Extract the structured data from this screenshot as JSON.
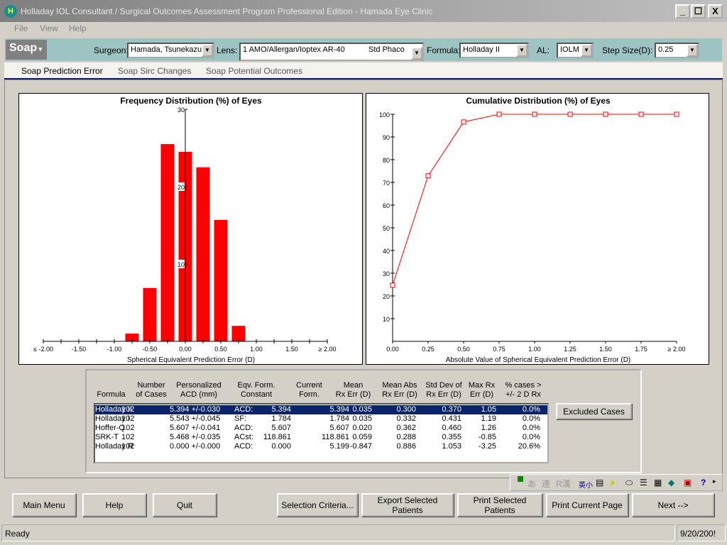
{
  "window": {
    "title": "Holladay IOL Consultant / Surgical Outcomes Assessment Program Professional Edition - Hamada Eye Clinic",
    "min": "_",
    "max": "☐",
    "close": "X",
    "logo": "H"
  },
  "menu": [
    "File",
    "View",
    "Help"
  ],
  "toolbar": {
    "soap": "Soap",
    "surgeon_label": "Surgeon:",
    "surgeon": "Hamada, Tsunekazu",
    "lens_label": "Lens:",
    "lens": "1  AMO/Allergan/Ioptex AR-40",
    "lens_type": "Std Phaco",
    "formula_label": "Formula:",
    "formula": "Holladay II",
    "al_label": "AL:",
    "al": "IOLM",
    "step_label": "Step Size(D):",
    "step": "0.25"
  },
  "tabs": [
    "Soap Prediction Error",
    "Soap Sirc Changes",
    "Soap Potential Outcomes"
  ],
  "chart_data": [
    {
      "type": "bar",
      "title": "Frequency Distribution (%) of Eyes",
      "xlabel": "Spherical Equivalent Prediction Error (D)",
      "ylabel": "",
      "x_tick_labels": [
        "≤ -2.00",
        "-1.50",
        "-1.00",
        "-0.50",
        "0.00",
        "0.50",
        "1.00",
        "1.50",
        "≥ 2.00"
      ],
      "y_tick_labels": [
        "10",
        "20",
        "30"
      ],
      "xlim": [
        -2,
        2
      ],
      "ylim": [
        0,
        30
      ],
      "categories": [
        -0.75,
        -0.5,
        -0.25,
        0,
        0.25,
        0.5,
        0.75
      ],
      "values": [
        1.0,
        6.9,
        25.5,
        24.5,
        22.5,
        15.7,
        2.0
      ],
      "color": "#ff0000",
      "grid": false
    },
    {
      "type": "line",
      "title": "Cumulative Distribution (%) of Eyes",
      "xlabel": "Absolute Value of Spherical Equivalent Prediction Error (D)",
      "ylabel": "",
      "x_tick_labels": [
        "0.00",
        "0.25",
        "0.50",
        "0.75",
        "1.00",
        "1.25",
        "1.50",
        "1.75",
        "≥ 2.00"
      ],
      "y_tick_labels": [
        "10",
        "20",
        "30",
        "40",
        "50",
        "60",
        "70",
        "80",
        "90",
        "100"
      ],
      "xlim": [
        0,
        2
      ],
      "ylim": [
        0,
        100
      ],
      "x": [
        0,
        0.25,
        0.5,
        0.75,
        1,
        1.25,
        1.5,
        1.75,
        2
      ],
      "values": [
        24.7,
        72.9,
        96.6,
        100,
        100,
        100,
        100,
        100,
        100
      ],
      "color": "#ff0000",
      "marker": "square",
      "grid": false
    }
  ],
  "table": {
    "headers": [
      "Formula",
      "Number\nof Cases",
      "Personalized\nACD (mm)",
      "Eqv. Form.\nConstant",
      "Current\nForm.",
      "Mean\nRx Err (D)",
      "Mean Abs\nRx Err (D)",
      "Std Dev of\nRx Err (D)",
      "Max Rx\nErr (D)",
      "% cases >\n+/- 2 D Rx"
    ],
    "rows": [
      [
        "Holladay II",
        "102",
        "5.394 +/-0.030",
        "ACD:",
        "5.394",
        "5.394",
        "0.035",
        "0.300",
        "0.370",
        "1.05",
        "0.0%"
      ],
      [
        "Holladay I",
        "102",
        "5.543 +/-0.045",
        "SF:",
        "1.784",
        "1.784",
        "0.035",
        "0.332",
        "0.431",
        "1.19",
        "0.0%"
      ],
      [
        "Hoffer-Q",
        "102",
        "5.607 +/-0.041",
        "ACD:",
        "5.607",
        "5.607",
        "0.020",
        "0.362",
        "0.460",
        "1.26",
        "0.0%"
      ],
      [
        "SRK-T",
        "102",
        "5.468 +/-0.035",
        "ACst:",
        "118.861",
        "118.861",
        "0.059",
        "0.288",
        "0.355",
        "-0.85",
        "0.0%"
      ],
      [
        "Holladay R",
        "102",
        "0.000 +/-0.000",
        "ACD:",
        "0.000",
        "5.199",
        "-0.847",
        "0.886",
        "1.053",
        "-3.25",
        "20.6%"
      ]
    ],
    "selected_row": 0,
    "excluded": "Excluded Cases"
  },
  "ime": [
    "あ",
    "連",
    "R漢",
    "英小",
    "?"
  ],
  "buttons": [
    "Main Menu",
    "Help",
    "Quit",
    "Selection Criteria...",
    "Export Selected Patients",
    "Print Selected Patients",
    "Print Current Page",
    "Next -->"
  ],
  "status": {
    "text": "Ready",
    "date": "9/20/200!"
  }
}
